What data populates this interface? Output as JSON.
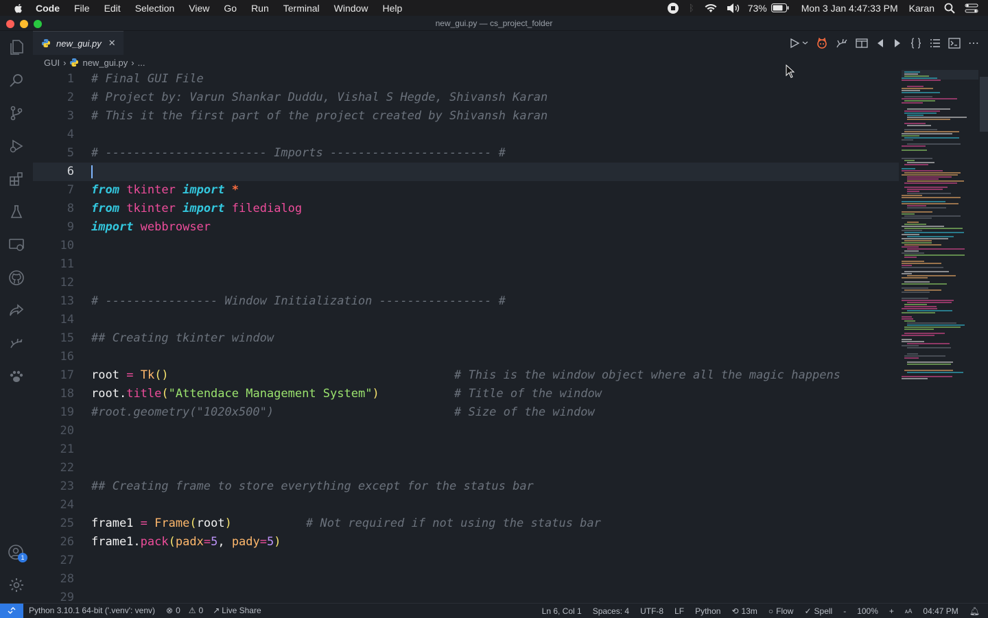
{
  "menubar": {
    "app": "Code",
    "items": [
      "File",
      "Edit",
      "Selection",
      "View",
      "Go",
      "Run",
      "Terminal",
      "Window",
      "Help"
    ],
    "battery": "73%",
    "datetime": "Mon 3 Jan  4:47:33 PM",
    "user": "Karan"
  },
  "window": {
    "title": "new_gui.py — cs_project_folder"
  },
  "tab": {
    "filename": "new_gui.py",
    "close": "✕"
  },
  "breadcrumb": {
    "folder": "GUI",
    "file": "new_gui.py",
    "more": "..."
  },
  "editor": {
    "current_line": 6,
    "lines": [
      {
        "n": "1"
      },
      {
        "n": "2"
      },
      {
        "n": "3"
      },
      {
        "n": "4"
      },
      {
        "n": "5"
      },
      {
        "n": "6"
      },
      {
        "n": "7"
      },
      {
        "n": "8"
      },
      {
        "n": "9"
      },
      {
        "n": "10"
      },
      {
        "n": "11"
      },
      {
        "n": "12"
      },
      {
        "n": "13"
      },
      {
        "n": "14"
      },
      {
        "n": "15"
      },
      {
        "n": "16"
      },
      {
        "n": "17"
      },
      {
        "n": "18"
      },
      {
        "n": "19"
      },
      {
        "n": "20"
      },
      {
        "n": "21"
      },
      {
        "n": "22"
      },
      {
        "n": "23"
      },
      {
        "n": "24"
      },
      {
        "n": "25"
      },
      {
        "n": "26"
      },
      {
        "n": "27"
      },
      {
        "n": "28"
      },
      {
        "n": "29"
      }
    ],
    "code": {
      "l1": "# Final GUI File",
      "l2": "# Project by: Varun Shankar Duddu, Vishal S Hegde, Shivansh Karan",
      "l3": "# This it the first part of the project created by Shivansh karan",
      "l5": "# ----------------------- Imports ----------------------- #",
      "l7_kw1": "from",
      "l7_mod": "tkinter",
      "l7_kw2": "import",
      "l7_star": "*",
      "l8_kw1": "from",
      "l8_mod": "tkinter",
      "l8_kw2": "import",
      "l8_name": "filedialog",
      "l9_kw": "import",
      "l9_mod": "webbrowser",
      "l13": "# ---------------- Window Initialization ---------------- #",
      "l15": "## Creating tkinter window",
      "l17_a": "root",
      "l17_op": "=",
      "l17_fn": "Tk",
      "l17_p": "()",
      "l17_cm": "# This is the window object where all the magic happens",
      "l18_a": "root",
      "l18_dot": ".",
      "l18_fn": "title",
      "l18_p1": "(",
      "l18_str": "\"Attendace Management System\"",
      "l18_p2": ")",
      "l18_cm": "# Title of the window",
      "l19_a": "#root.geometry(\"1020x500\")",
      "l19_cm": "# Size of the window",
      "l23": "## Creating frame to store everything except for the status bar",
      "l25_a": "frame1",
      "l25_op": "=",
      "l25_fn": "Frame",
      "l25_p1": "(",
      "l25_arg": "root",
      "l25_p2": ")",
      "l25_cm": "# Not required if not using the status bar",
      "l26_a": "frame1",
      "l26_dot": ".",
      "l26_fn": "pack",
      "l26_p1": "(",
      "l26_k1": "padx",
      "l26_eq1": "=",
      "l26_v1": "5",
      "l26_comma": ", ",
      "l26_k2": "pady",
      "l26_eq2": "=",
      "l26_v2": "5",
      "l26_p2": ")"
    }
  },
  "statusbar": {
    "interpreter": "Python 3.10.1 64-bit ('.venv': venv)",
    "errors": "0",
    "warnings": "0",
    "live_share": "Live Share",
    "position": "Ln 6, Col 1",
    "spaces": "Spaces: 4",
    "encoding": "UTF-8",
    "eol": "LF",
    "language": "Python",
    "time_tracked": "13m",
    "flow": "Flow",
    "spell": "Spell",
    "zoom_minus": "-",
    "zoom": "100%",
    "zoom_plus": "+",
    "clock": "04:47 PM"
  },
  "accounts_badge": "1",
  "colors": {
    "background": "#1d2127",
    "comment": "#6b727c",
    "keyword": "#33c7de",
    "module": "#ee4d9b",
    "function": "#ffb86c",
    "string": "#9be36e",
    "number": "#bd93f9",
    "accent": "#2f7ae5"
  },
  "icons": [
    "apple-icon",
    "record-icon",
    "bluetooth-icon",
    "wifi-icon",
    "volume-icon",
    "battery-icon",
    "search-icon",
    "control-center-icon",
    "explorer-icon",
    "search-icon",
    "source-control-icon",
    "run-debug-icon",
    "extensions-icon",
    "testing-icon",
    "remote-explorer-icon",
    "github-icon",
    "live-share-icon",
    "docker-icon",
    "paw-icon",
    "accounts-icon",
    "settings-gear-icon"
  ]
}
